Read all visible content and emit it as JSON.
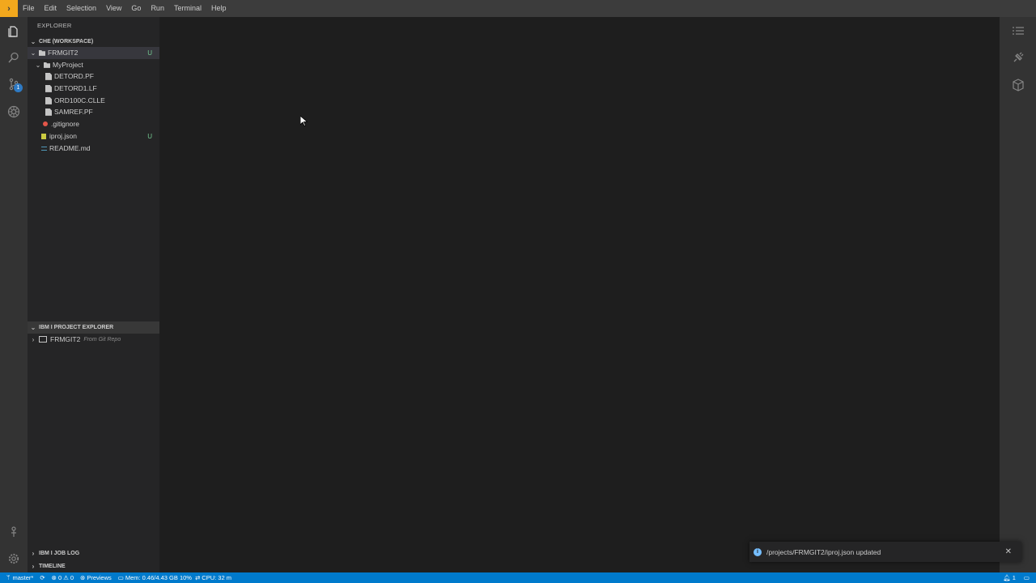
{
  "menubar": {
    "items": [
      "File",
      "Edit",
      "Selection",
      "View",
      "Go",
      "Run",
      "Terminal",
      "Help"
    ]
  },
  "activitybar": {
    "icons": [
      "files-icon",
      "search-icon",
      "source-control-icon",
      "debug-icon",
      "account-icon",
      "settings-icon"
    ],
    "scm_badge": "1"
  },
  "sidebar": {
    "title": "EXPLORER",
    "workspace_label": "CHE (WORKSPACE)",
    "tree": [
      {
        "label": "FRMGIT2",
        "status": "U"
      },
      {
        "label": "MyProject",
        "status": ""
      },
      {
        "label": "DETORD.PF",
        "status": ""
      },
      {
        "label": "DETORD1.LF",
        "status": ""
      },
      {
        "label": "ORD100C.CLLE",
        "status": ""
      },
      {
        "label": "SAMREF.PF",
        "status": ""
      },
      {
        "label": ".gitignore",
        "status": ""
      },
      {
        "label": "iproj.json",
        "status": "U"
      },
      {
        "label": "README.md",
        "status": ""
      }
    ],
    "project_explorer": {
      "title": "IBM I PROJECT EXPLORER",
      "item_label": "FRMGIT2",
      "item_desc": "From Git Repo"
    },
    "job_log_title": "IBM I JOB LOG",
    "timeline_title": "TIMELINE"
  },
  "notification": {
    "text": "/projects/FRMGIT2/iproj.json updated"
  },
  "statusbar": {
    "branch": "master*",
    "errors": "0",
    "warnings": "0",
    "previews": "Previews",
    "memory": "Mem: 0.46/4.43 GB 10%",
    "cpu": "CPU: 32 m",
    "notif_count": "1"
  },
  "colors": {
    "accent": "#007acc",
    "logo": "#f2a81d",
    "untracked": "#73c991"
  }
}
